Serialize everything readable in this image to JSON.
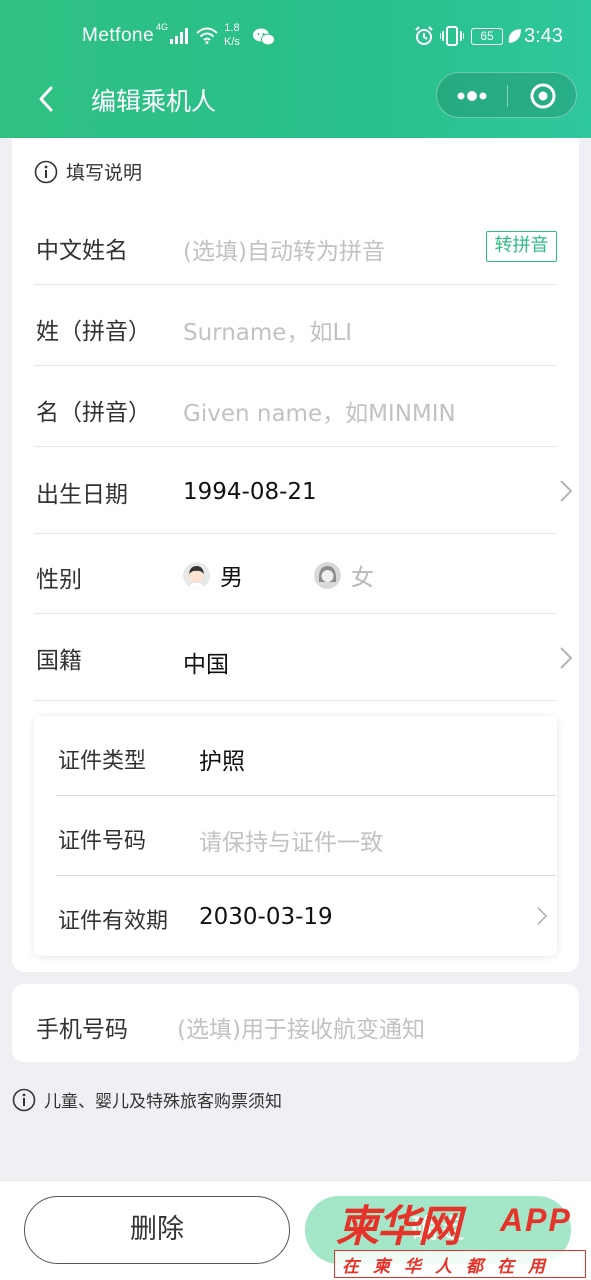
{
  "status_bar": {
    "carrier": "Metfone",
    "network": "4G",
    "speed_value": "1.8",
    "speed_unit": "K/s",
    "battery": "65",
    "time": "3:43"
  },
  "nav": {
    "title": "编辑乘机人"
  },
  "form": {
    "hint": "填写说明",
    "chinese_name": {
      "label": "中文姓名",
      "placeholder": "(选填)自动转为拼音",
      "button": "转拼音"
    },
    "surname": {
      "label": "姓（拼音）",
      "placeholder": "Surname，如LI"
    },
    "given_name": {
      "label": "名（拼音）",
      "placeholder": "Given name，如MINMIN"
    },
    "birth_date": {
      "label": "出生日期",
      "value": "1994-08-21"
    },
    "gender": {
      "label": "性别",
      "male": "男",
      "female": "女",
      "selected": "男"
    },
    "nationality": {
      "label": "国籍",
      "value": "中国"
    },
    "id_type": {
      "label": "证件类型",
      "value": "护照"
    },
    "id_number": {
      "label": "证件号码",
      "placeholder": "请保持与证件一致"
    },
    "id_expiry": {
      "label": "证件有效期",
      "value": "2030-03-19"
    },
    "phone": {
      "label": "手机号码",
      "placeholder": "(选填)用于接收航变通知"
    }
  },
  "notice": "儿童、婴儿及特殊旅客购票须知",
  "actions": {
    "delete": "删除",
    "confirm": "确定"
  },
  "watermark": {
    "brand": "柬华网",
    "app": "APP",
    "tagline": "在柬华人都在用"
  },
  "colors": {
    "header_green": "#2fc182",
    "accent_green": "#2fbe82",
    "confirm_disabled": "#a4e6c8",
    "watermark_red": "#e6332a"
  }
}
